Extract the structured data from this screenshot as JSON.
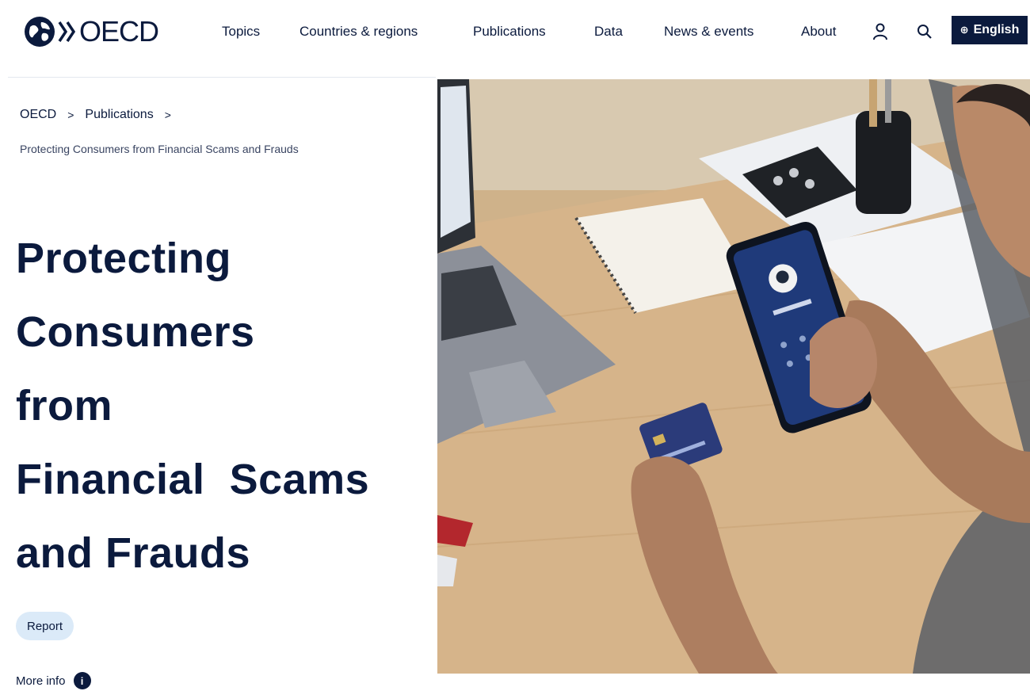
{
  "header": {
    "logo_text": "OECD",
    "nav": [
      "Topics",
      "Countries & regions",
      "Publications",
      "Data",
      "News & events",
      "About"
    ],
    "language_label": "English",
    "language_glyph": "⊕",
    "user_icon": "user-icon",
    "search_icon": "search-icon"
  },
  "breadcrumb": {
    "home": "OECD",
    "section": "Publications",
    "separator": ">",
    "current": "Protecting Consumers from Financial Scams and Frauds"
  },
  "title_lines": [
    "Protecting",
    "Consumers",
    "from",
    "Financial  Scams",
    "and Frauds"
  ],
  "badge": "Report",
  "more_info": {
    "label": "More info",
    "icon": "info-icon",
    "icon_glyph": "i"
  },
  "colors": {
    "navy": "#0b1a3d",
    "badge_bg": "#dbeaf8",
    "rule": "#e4e8ef"
  }
}
